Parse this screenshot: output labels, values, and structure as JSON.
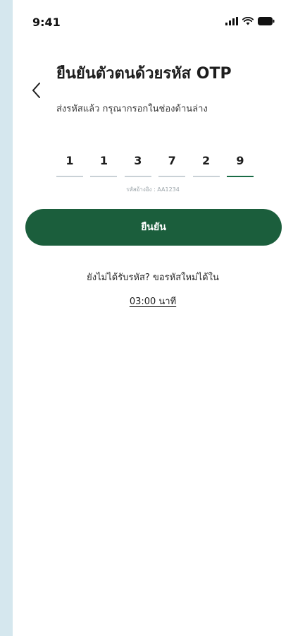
{
  "status_bar": {
    "time": "9:41"
  },
  "header": {
    "title": "ยืนยันตัวตนด้วยรหัส OTP",
    "subtitle": "ส่งรหัสแล้ว กรุณากรอกในช่องด้านล่าง"
  },
  "otp": {
    "digits": [
      "1",
      "1",
      "3",
      "7",
      "2",
      "9"
    ],
    "reference": "รหัสอ้างอิง : AA1234",
    "active_color": "#1a6b45"
  },
  "actions": {
    "confirm_label": "ยืนยัน",
    "resend_prompt": "ยังไม่ได้รับรหัส? ขอรหัสใหม่ได้ใน",
    "timer": "03:00 นาที"
  },
  "colors": {
    "primary": "#1b5e3c",
    "background": "#d5e7ee"
  },
  "icons": {
    "back": "chevron-left-icon",
    "signal": "signal-icon",
    "wifi": "wifi-icon",
    "battery": "battery-icon"
  }
}
